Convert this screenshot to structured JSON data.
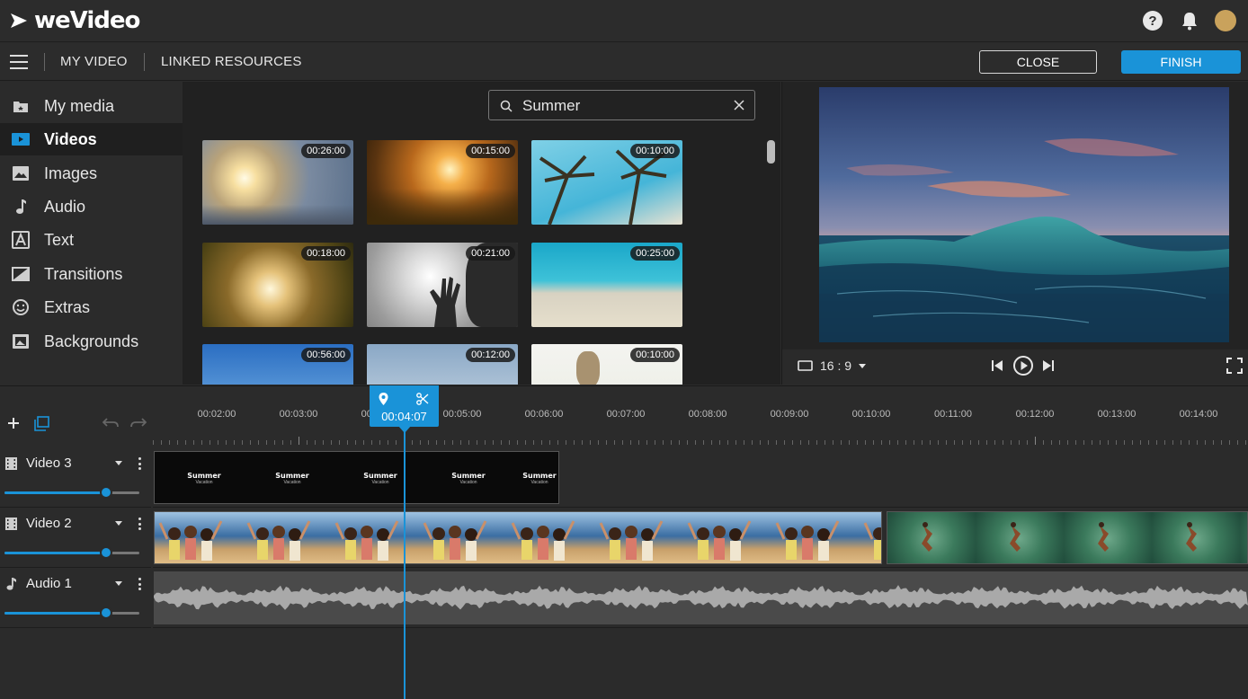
{
  "app": {
    "logo_text": "weVideo"
  },
  "menu": {
    "my_video": "MY VIDEO",
    "linked_resources": "LINKED RESOURCES",
    "close_label": "CLOSE",
    "finish_label": "FINISH"
  },
  "sidebar": {
    "items": [
      {
        "label": "My media",
        "icon": "my-media-icon"
      },
      {
        "label": "Videos",
        "icon": "videos-icon",
        "active": true
      },
      {
        "label": "Images",
        "icon": "images-icon"
      },
      {
        "label": "Audio",
        "icon": "audio-note-icon"
      },
      {
        "label": "Text",
        "icon": "text-icon"
      },
      {
        "label": "Transitions",
        "icon": "transitions-icon"
      },
      {
        "label": "Extras",
        "icon": "smiley-icon"
      },
      {
        "label": "Backgrounds",
        "icon": "backgrounds-icon"
      }
    ]
  },
  "search": {
    "value": "Summer"
  },
  "media_thumbs": [
    {
      "duration": "00:26:00"
    },
    {
      "duration": "00:15:00"
    },
    {
      "duration": "00:10:00"
    },
    {
      "duration": "00:18:00"
    },
    {
      "duration": "00:21:00"
    },
    {
      "duration": "00:25:00"
    },
    {
      "duration": "00:56:00"
    },
    {
      "duration": "00:12:00"
    },
    {
      "duration": "00:10:00"
    }
  ],
  "preview": {
    "aspect_ratio": "16 : 9"
  },
  "timeline": {
    "ticks": [
      "00:02:00",
      "00:03:00",
      "00:04:00",
      "00:05:00",
      "00:06:00",
      "00:07:00",
      "00:08:00",
      "00:09:00",
      "00:10:00",
      "00:11:00",
      "00:12:00",
      "00:13:00",
      "00:14:00"
    ],
    "playhead_time": "00:04:07",
    "tracks": [
      {
        "name": "Video 3",
        "volume": 0.75
      },
      {
        "name": "Video 2",
        "volume": 0.75
      },
      {
        "name": "Audio 1",
        "volume": 0.75
      }
    ],
    "title_card": {
      "line1": "Summer",
      "line2": "Vacation"
    }
  },
  "colors": {
    "accent": "#1a93d8",
    "background": "#2b2b2b"
  }
}
